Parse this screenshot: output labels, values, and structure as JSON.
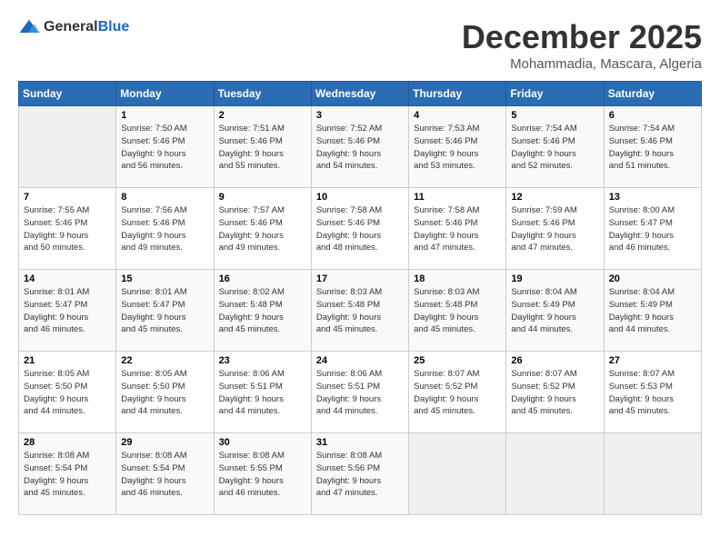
{
  "logo": {
    "general": "General",
    "blue": "Blue"
  },
  "title": "December 2025",
  "location": "Mohammadia, Mascara, Algeria",
  "days_of_week": [
    "Sunday",
    "Monday",
    "Tuesday",
    "Wednesday",
    "Thursday",
    "Friday",
    "Saturday"
  ],
  "weeks": [
    [
      {
        "day": null,
        "content": null
      },
      {
        "day": "1",
        "content": "Sunrise: 7:50 AM\nSunset: 5:46 PM\nDaylight: 9 hours\nand 56 minutes."
      },
      {
        "day": "2",
        "content": "Sunrise: 7:51 AM\nSunset: 5:46 PM\nDaylight: 9 hours\nand 55 minutes."
      },
      {
        "day": "3",
        "content": "Sunrise: 7:52 AM\nSunset: 5:46 PM\nDaylight: 9 hours\nand 54 minutes."
      },
      {
        "day": "4",
        "content": "Sunrise: 7:53 AM\nSunset: 5:46 PM\nDaylight: 9 hours\nand 53 minutes."
      },
      {
        "day": "5",
        "content": "Sunrise: 7:54 AM\nSunset: 5:46 PM\nDaylight: 9 hours\nand 52 minutes."
      },
      {
        "day": "6",
        "content": "Sunrise: 7:54 AM\nSunset: 5:46 PM\nDaylight: 9 hours\nand 51 minutes."
      }
    ],
    [
      {
        "day": "7",
        "content": "Sunrise: 7:55 AM\nSunset: 5:46 PM\nDaylight: 9 hours\nand 50 minutes."
      },
      {
        "day": "8",
        "content": "Sunrise: 7:56 AM\nSunset: 5:46 PM\nDaylight: 9 hours\nand 49 minutes."
      },
      {
        "day": "9",
        "content": "Sunrise: 7:57 AM\nSunset: 5:46 PM\nDaylight: 9 hours\nand 49 minutes."
      },
      {
        "day": "10",
        "content": "Sunrise: 7:58 AM\nSunset: 5:46 PM\nDaylight: 9 hours\nand 48 minutes."
      },
      {
        "day": "11",
        "content": "Sunrise: 7:58 AM\nSunset: 5:46 PM\nDaylight: 9 hours\nand 47 minutes."
      },
      {
        "day": "12",
        "content": "Sunrise: 7:59 AM\nSunset: 5:46 PM\nDaylight: 9 hours\nand 47 minutes."
      },
      {
        "day": "13",
        "content": "Sunrise: 8:00 AM\nSunset: 5:47 PM\nDaylight: 9 hours\nand 46 minutes."
      }
    ],
    [
      {
        "day": "14",
        "content": "Sunrise: 8:01 AM\nSunset: 5:47 PM\nDaylight: 9 hours\nand 46 minutes."
      },
      {
        "day": "15",
        "content": "Sunrise: 8:01 AM\nSunset: 5:47 PM\nDaylight: 9 hours\nand 45 minutes."
      },
      {
        "day": "16",
        "content": "Sunrise: 8:02 AM\nSunset: 5:48 PM\nDaylight: 9 hours\nand 45 minutes."
      },
      {
        "day": "17",
        "content": "Sunrise: 8:03 AM\nSunset: 5:48 PM\nDaylight: 9 hours\nand 45 minutes."
      },
      {
        "day": "18",
        "content": "Sunrise: 8:03 AM\nSunset: 5:48 PM\nDaylight: 9 hours\nand 45 minutes."
      },
      {
        "day": "19",
        "content": "Sunrise: 8:04 AM\nSunset: 5:49 PM\nDaylight: 9 hours\nand 44 minutes."
      },
      {
        "day": "20",
        "content": "Sunrise: 8:04 AM\nSunset: 5:49 PM\nDaylight: 9 hours\nand 44 minutes."
      }
    ],
    [
      {
        "day": "21",
        "content": "Sunrise: 8:05 AM\nSunset: 5:50 PM\nDaylight: 9 hours\nand 44 minutes."
      },
      {
        "day": "22",
        "content": "Sunrise: 8:05 AM\nSunset: 5:50 PM\nDaylight: 9 hours\nand 44 minutes."
      },
      {
        "day": "23",
        "content": "Sunrise: 8:06 AM\nSunset: 5:51 PM\nDaylight: 9 hours\nand 44 minutes."
      },
      {
        "day": "24",
        "content": "Sunrise: 8:06 AM\nSunset: 5:51 PM\nDaylight: 9 hours\nand 44 minutes."
      },
      {
        "day": "25",
        "content": "Sunrise: 8:07 AM\nSunset: 5:52 PM\nDaylight: 9 hours\nand 45 minutes."
      },
      {
        "day": "26",
        "content": "Sunrise: 8:07 AM\nSunset: 5:52 PM\nDaylight: 9 hours\nand 45 minutes."
      },
      {
        "day": "27",
        "content": "Sunrise: 8:07 AM\nSunset: 5:53 PM\nDaylight: 9 hours\nand 45 minutes."
      }
    ],
    [
      {
        "day": "28",
        "content": "Sunrise: 8:08 AM\nSunset: 5:54 PM\nDaylight: 9 hours\nand 45 minutes."
      },
      {
        "day": "29",
        "content": "Sunrise: 8:08 AM\nSunset: 5:54 PM\nDaylight: 9 hours\nand 46 minutes."
      },
      {
        "day": "30",
        "content": "Sunrise: 8:08 AM\nSunset: 5:55 PM\nDaylight: 9 hours\nand 46 minutes."
      },
      {
        "day": "31",
        "content": "Sunrise: 8:08 AM\nSunset: 5:56 PM\nDaylight: 9 hours\nand 47 minutes."
      },
      {
        "day": null,
        "content": null
      },
      {
        "day": null,
        "content": null
      },
      {
        "day": null,
        "content": null
      }
    ]
  ]
}
